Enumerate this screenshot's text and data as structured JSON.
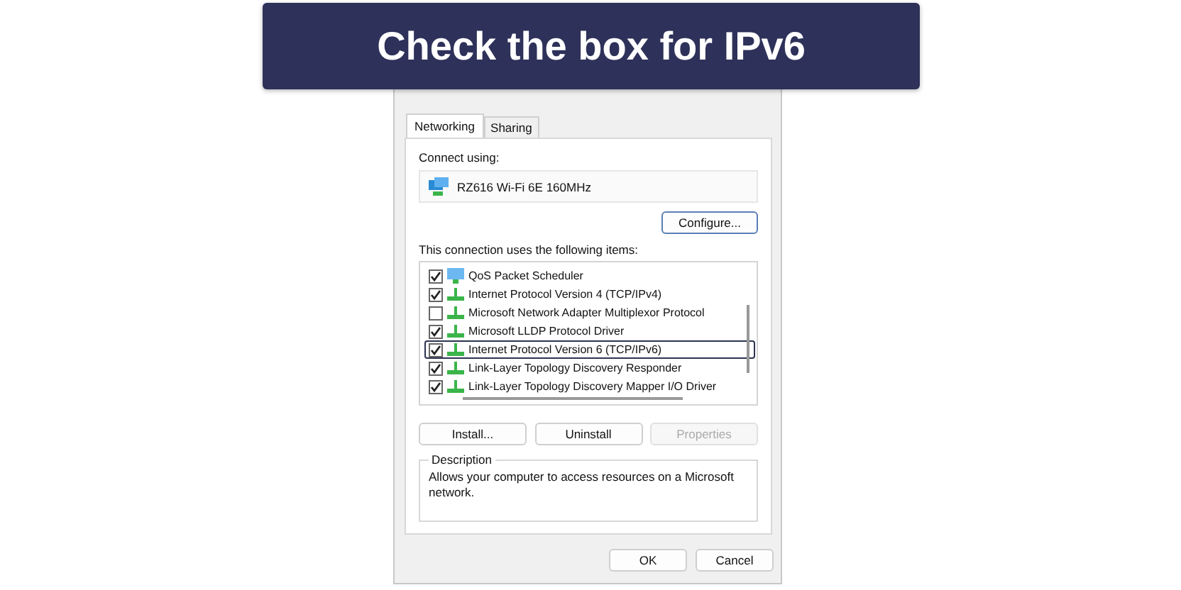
{
  "banner": {
    "title": "Check the box for IPv6"
  },
  "tabs": [
    {
      "label": "Networking",
      "selected": true
    },
    {
      "label": "Sharing",
      "selected": false
    }
  ],
  "connect_using": {
    "label": "Connect using:",
    "adapter": "RZ616 Wi-Fi 6E 160MHz",
    "button": "Configure..."
  },
  "items_label": "This connection uses the following items:",
  "items": [
    {
      "label": "QoS Packet Scheduler",
      "kind": "scheduler",
      "checked": true,
      "selected": false
    },
    {
      "label": "Internet Protocol Version 4 (TCP/IPv4)",
      "kind": "protocol",
      "checked": true,
      "selected": false
    },
    {
      "label": "Microsoft Network Adapter Multiplexor Protocol",
      "kind": "protocol",
      "checked": false,
      "selected": false
    },
    {
      "label": "Microsoft LLDP Protocol Driver",
      "kind": "protocol",
      "checked": true,
      "selected": false
    },
    {
      "label": "Internet Protocol Version 6 (TCP/IPv6)",
      "kind": "protocol",
      "checked": true,
      "selected": true
    },
    {
      "label": "Link-Layer Topology Discovery Responder",
      "kind": "protocol",
      "checked": true,
      "selected": false
    },
    {
      "label": "Link-Layer Topology Discovery Mapper I/O Driver",
      "kind": "protocol",
      "checked": true,
      "selected": false
    }
  ],
  "item_buttons": [
    {
      "label": "Install...",
      "disabled": false
    },
    {
      "label": "Uninstall",
      "disabled": false
    },
    {
      "label": "Properties",
      "disabled": true
    }
  ],
  "description": {
    "legend": "Description",
    "text": "Allows your computer to access resources on a Microsoft network."
  },
  "footer_buttons": [
    "OK",
    "Cancel"
  ]
}
